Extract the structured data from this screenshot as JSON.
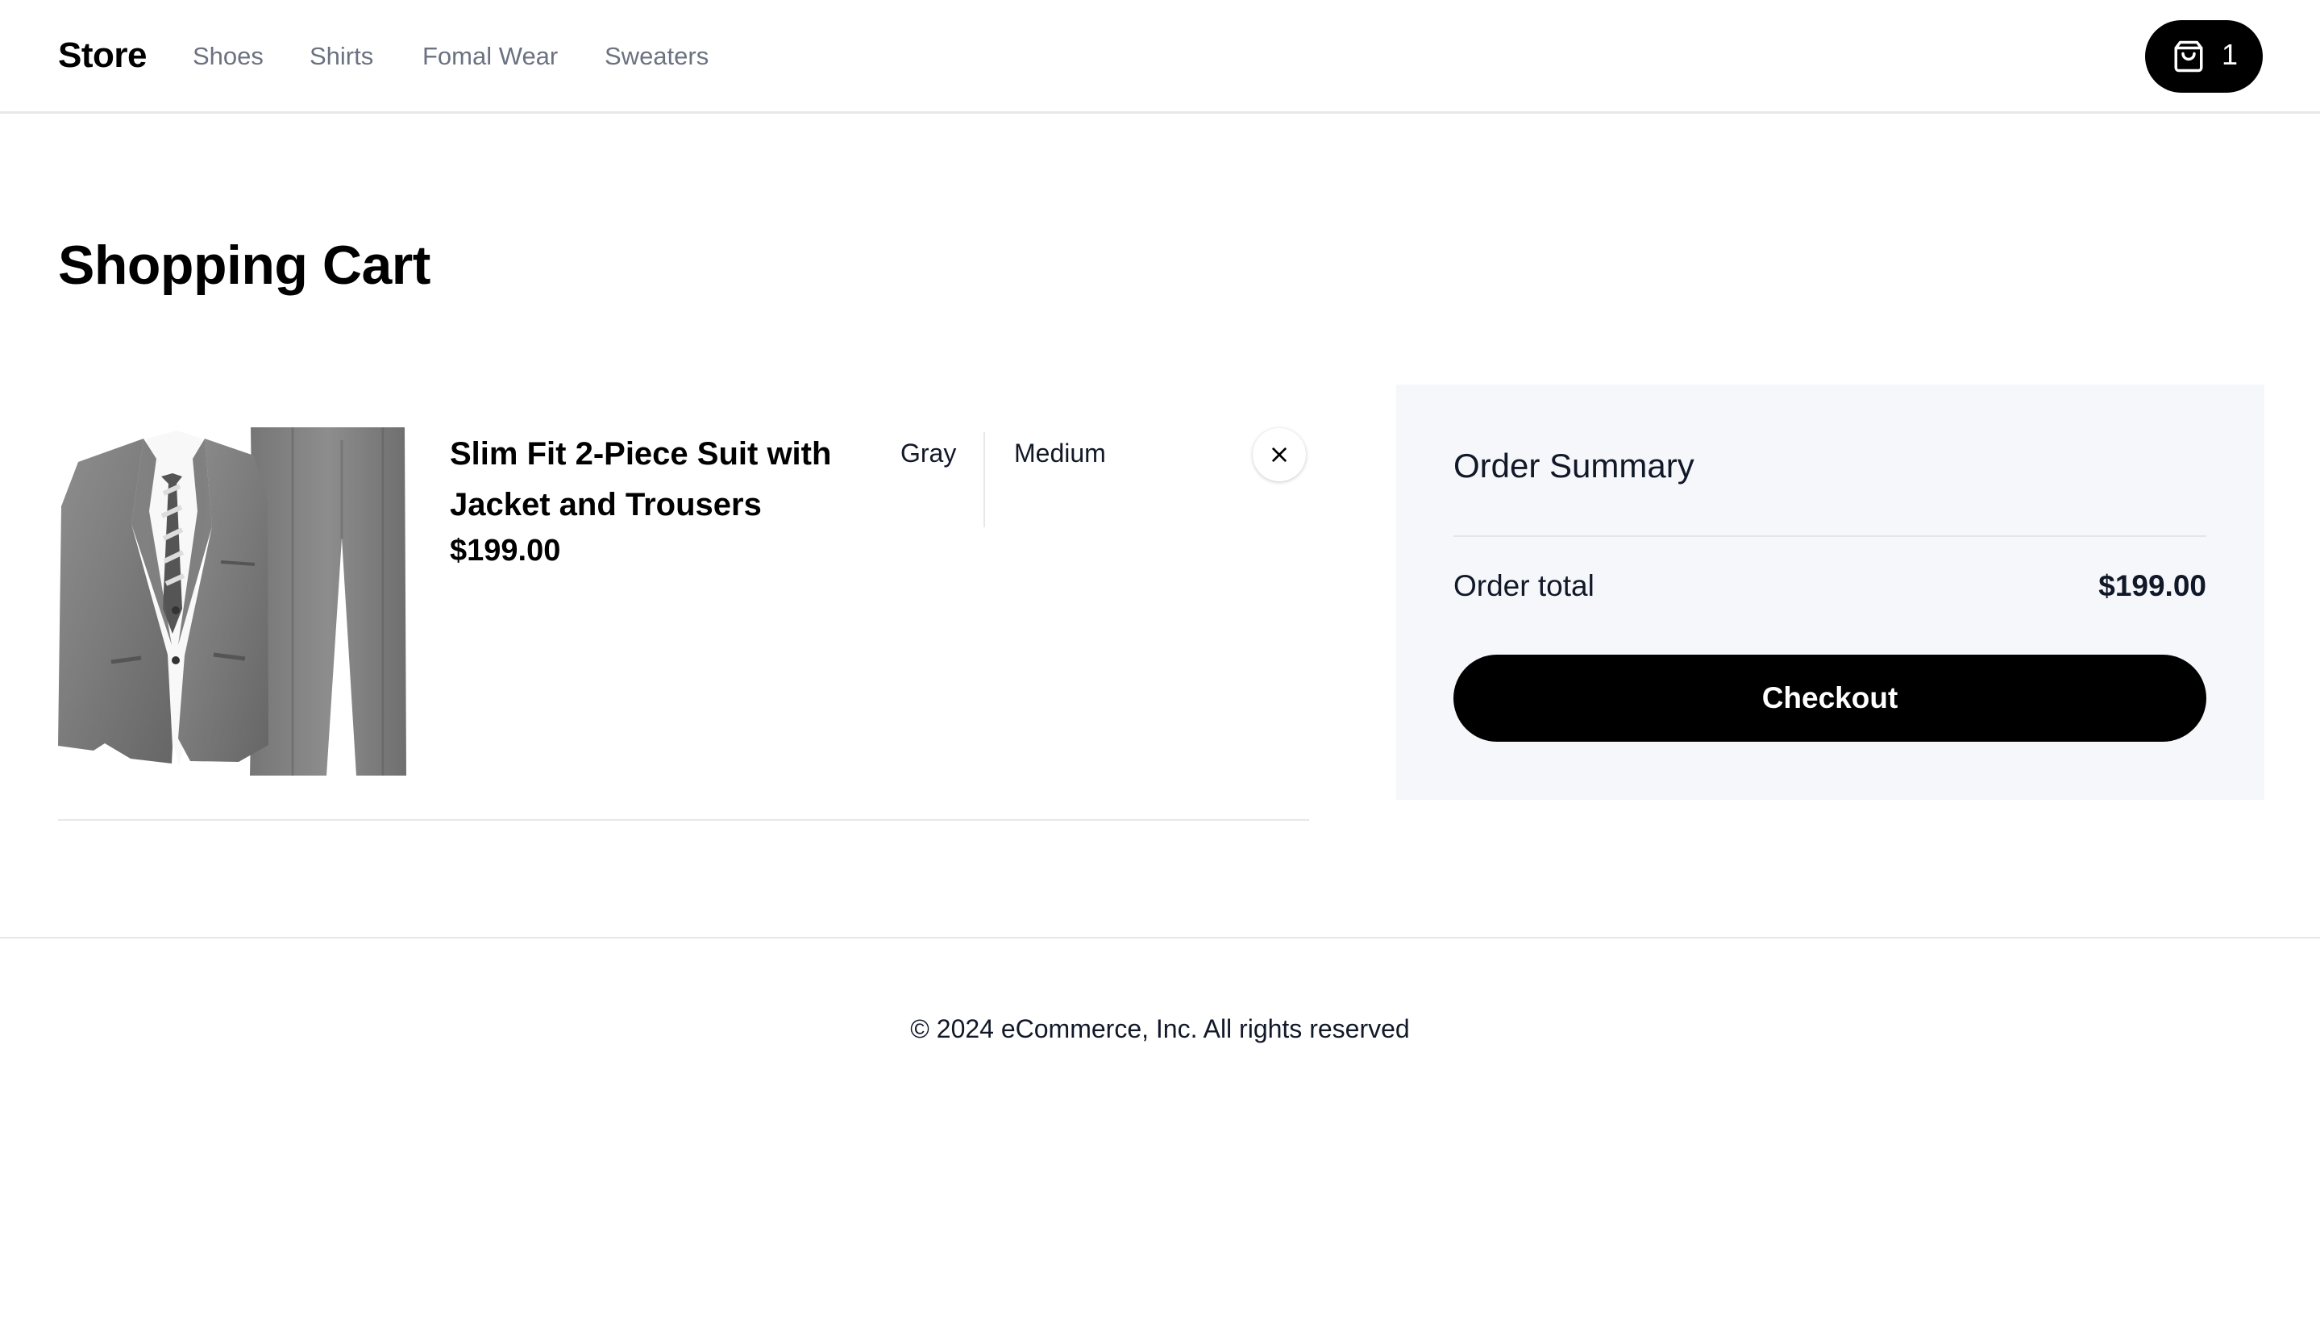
{
  "header": {
    "brand": "Store",
    "nav": [
      "Shoes",
      "Shirts",
      "Fomal Wear",
      "Sweaters"
    ],
    "cart": {
      "icon": "shopping-bag-icon",
      "count": "1"
    }
  },
  "main": {
    "title": "Shopping Cart",
    "cart_items": [
      {
        "name": "Slim Fit 2-Piece Suit with Jacket and Trousers",
        "price": "$199.00",
        "color": "Gray",
        "size": "Medium",
        "image": "gray-suit-product-image",
        "remove_icon": "close-icon"
      }
    ]
  },
  "summary": {
    "title": "Order Summary",
    "total_label": "Order total",
    "total_value": "$199.00",
    "checkout_label": "Checkout"
  },
  "footer": {
    "text": "© 2024 eCommerce, Inc. All rights reserved"
  },
  "colors": {
    "accent": "#000000",
    "summary_background": "#f5f7fa",
    "nav_text": "#6b7280",
    "divider": "#e5e7eb"
  }
}
